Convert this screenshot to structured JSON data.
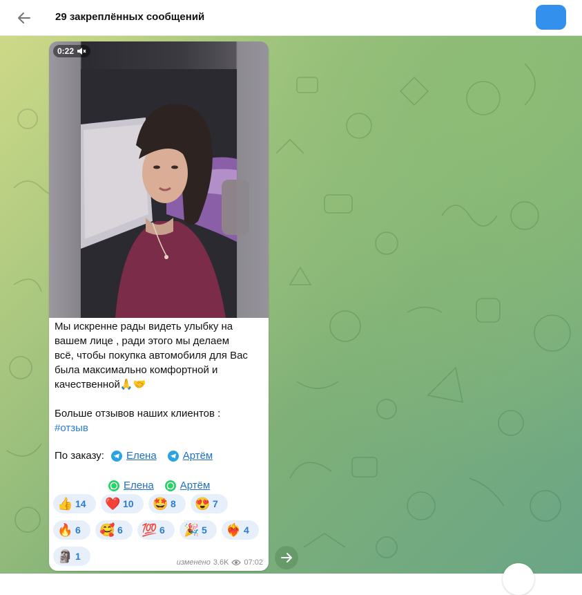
{
  "header": {
    "title": "29 закреплённых сообщений",
    "back_icon": "arrow-left-icon",
    "action_color": "#3390ec"
  },
  "message": {
    "video": {
      "duration": "0:22",
      "muted_icon": "muted-speaker-icon"
    },
    "text_lines": [
      "Мы искренне рады видеть улыбку на",
      "вашем лице , ради этого мы делаем",
      "всё, чтобы покупка автомобиля для Вас",
      "была максимально комфортной и",
      "качественной🙏🤝"
    ],
    "more_reviews": "Больше отзывов наших клиентов :",
    "hashtag": "#отзыв",
    "order_label": "По заказу:",
    "telegram_contacts": [
      "Елена",
      "Артём"
    ],
    "whatsapp_contacts": [
      "Елена",
      "Артём"
    ],
    "reactions": [
      {
        "emoji": "👍",
        "count": "14"
      },
      {
        "emoji": "❤️",
        "count": "10"
      },
      {
        "emoji": "🤩",
        "count": "8"
      },
      {
        "emoji": "😍",
        "count": "7"
      },
      {
        "emoji": "🔥",
        "count": "6"
      },
      {
        "emoji": "🥰",
        "count": "6"
      },
      {
        "emoji": "💯",
        "count": "6"
      },
      {
        "emoji": "🎉",
        "count": "5"
      },
      {
        "emoji": "❤️‍🔥",
        "count": "4"
      },
      {
        "emoji": "🗿",
        "count": "1"
      }
    ],
    "edited_label": "изменено",
    "views": "3.6K",
    "time": "07:02"
  },
  "colors": {
    "link": "#1f6fc5",
    "reaction_bg": "#e7f0fa",
    "reaction_count": "#2b7bd0"
  }
}
